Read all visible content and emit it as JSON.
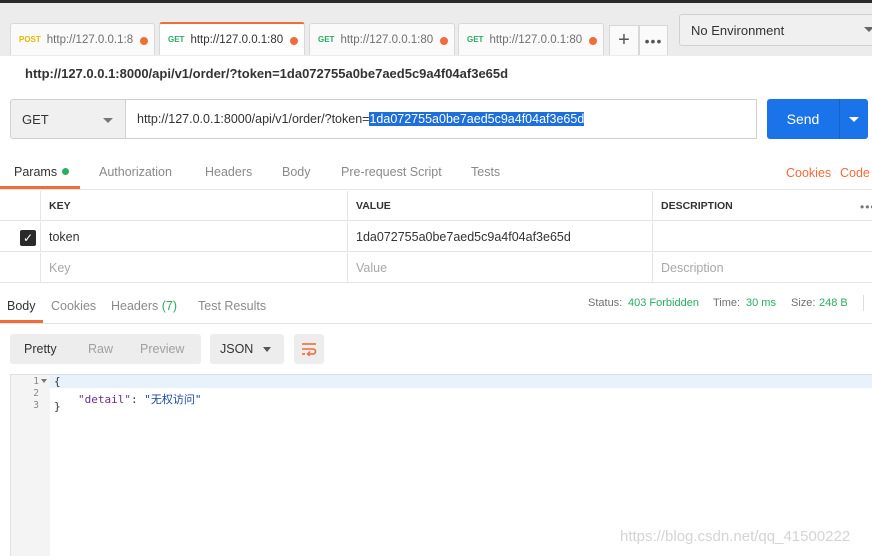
{
  "tabs": [
    {
      "method": "POST",
      "method_color": "#e6b800",
      "url": "http://127.0.0.1:8"
    },
    {
      "method": "GET",
      "method_color": "#27ae60",
      "url": "http://127.0.0.1:80"
    },
    {
      "method": "GET",
      "method_color": "#27ae60",
      "url": "http://127.0.0.1:80"
    },
    {
      "method": "GET",
      "method_color": "#27ae60",
      "url": "http://127.0.0.1:80"
    }
  ],
  "tab_actions": {
    "add_icon": "+",
    "more_icon": "•••"
  },
  "environment": {
    "label": "No Environment"
  },
  "request_title": "http://127.0.0.1:8000/api/v1/order/?token=1da072755a0be7aed5c9a4f04af3e65d",
  "request": {
    "method": "GET",
    "url_prefix": "http://127.0.0.1:8000/api/v1/order/?token=",
    "url_selected": "1da072755a0be7aed5c9a4f04af3e65d",
    "send_label": "Send"
  },
  "request_tabs": {
    "params": "Params",
    "authorization": "Authorization",
    "headers": "Headers",
    "body": "Body",
    "prerequest": "Pre-request Script",
    "tests": "Tests",
    "cookies": "Cookies",
    "code": "Code"
  },
  "params_table": {
    "headers": {
      "key": "KEY",
      "value": "VALUE",
      "description": "DESCRIPTION"
    },
    "rows": [
      {
        "key": "token",
        "value": "1da072755a0be7aed5c9a4f04af3e65d",
        "description": ""
      }
    ],
    "placeholder": {
      "key": "Key",
      "value": "Value",
      "description": "Description"
    }
  },
  "response_tabs": {
    "body": "Body",
    "cookies": "Cookies",
    "headers": "Headers",
    "headers_count": "(7)",
    "test_results": "Test Results"
  },
  "response_status": {
    "status_label": "Status:",
    "status_value": "403 Forbidden",
    "time_label": "Time:",
    "time_value": "30 ms",
    "size_label": "Size:",
    "size_value": "248 B"
  },
  "response_toolbar": {
    "pretty": "Pretty",
    "raw": "Raw",
    "preview": "Preview",
    "format": "JSON"
  },
  "response_body": {
    "line_numbers": [
      "1",
      "2",
      "3"
    ],
    "open_brace": "{",
    "key": "\"detail\"",
    "colon": ": ",
    "value": "\"无权访问\"",
    "close_brace": "}"
  },
  "watermark": "https://blog.csdn.net/qq_41500222",
  "colors": {
    "accent": "#f26b3a",
    "send": "#1a73e8",
    "success": "#27ae60"
  }
}
